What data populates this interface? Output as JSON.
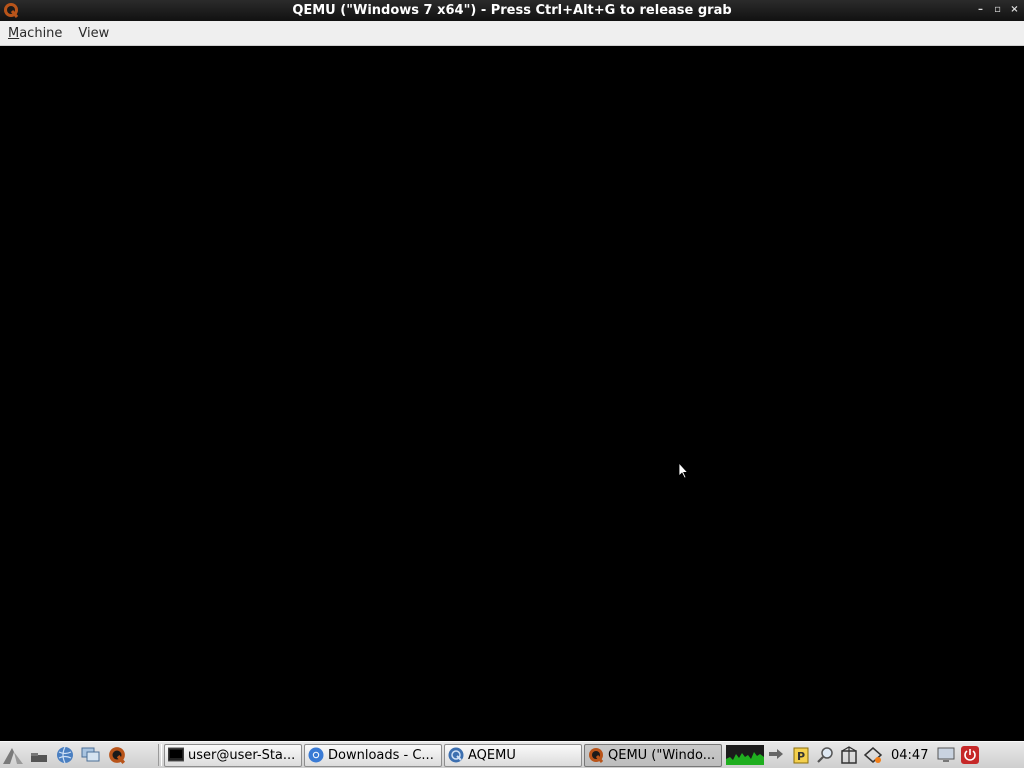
{
  "window": {
    "title": "QEMU (\"Windows 7 x64\") - Press Ctrl+Alt+G to release grab",
    "controls": {
      "minimize": "–",
      "restore": "▫",
      "close": "×"
    }
  },
  "menubar": {
    "items": [
      {
        "label": "Machine",
        "mnemonic": "M",
        "rest": "achine"
      },
      {
        "label": "View",
        "mnemonic": "",
        "rest": "View"
      }
    ]
  },
  "taskbar": {
    "tasks": [
      {
        "label": "user@user-Sta...",
        "icon": "terminal-icon"
      },
      {
        "label": "Downloads - C...",
        "icon": "chrome-icon"
      },
      {
        "label": "AQEMU",
        "icon": "aqemu-icon"
      },
      {
        "label": "QEMU (\"Windo...",
        "icon": "qemu-icon",
        "active": true
      }
    ],
    "clock": "04:47"
  },
  "colors": {
    "titlebar": "#1e1e1e",
    "menubar": "#efefef",
    "screen": "#000000",
    "taskbar": "#dcdcdc"
  }
}
